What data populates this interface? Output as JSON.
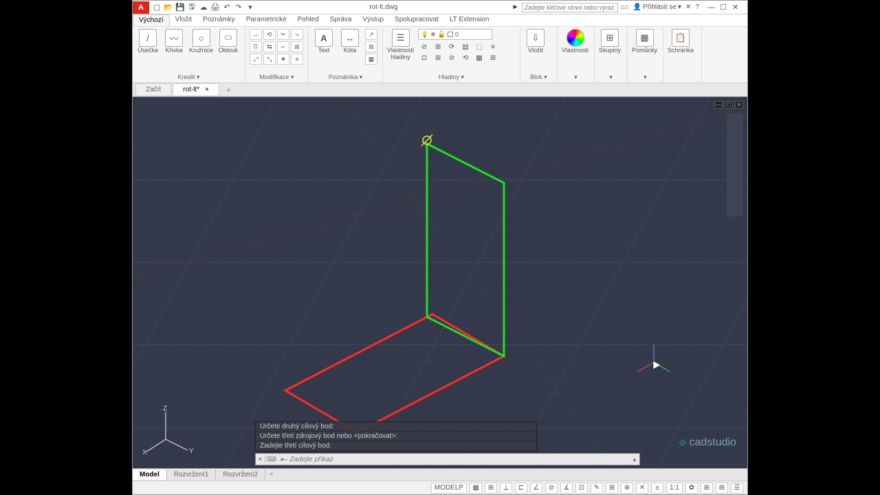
{
  "title": {
    "doc": "rot-lt.dwg",
    "app_badge": "A"
  },
  "qat_icons": [
    "new",
    "open",
    "save",
    "saveas",
    "cloud",
    "plot",
    "undo",
    "redo"
  ],
  "search": {
    "placeholder": "Zadejte klíčové slovo nebo výraz.",
    "arrow": "►"
  },
  "title_right": {
    "share": "⌂⌂",
    "signin": "Přihlásit se",
    "exchange": "✕",
    "help": "?",
    "min": "—",
    "max": "☐",
    "close": "✕"
  },
  "ribbon_tabs": [
    "Výchozí",
    "Vložit",
    "Poznámky",
    "Parametrické",
    "Pohled",
    "Správa",
    "Výstup",
    "Spolupracovat",
    "LT Extension"
  ],
  "ribbon_active": 0,
  "panels": {
    "draw": {
      "title": "Kreslit ▾",
      "btns": [
        {
          "icon": "/",
          "label": "Úsečka"
        },
        {
          "icon": "〰",
          "label": "Křivka"
        },
        {
          "icon": "○",
          "label": "Kružnice"
        },
        {
          "icon": "⬭",
          "label": "Oblouk"
        }
      ],
      "grid": [
        "□",
        "⟳",
        "·",
        "⊞",
        "⌇",
        "⬡",
        "·",
        "◆"
      ]
    },
    "modify": {
      "title": "Modifikace ▾",
      "grid": [
        "↔",
        "Ȼ",
        "⤷",
        "⤢",
        "✂",
        "⟲",
        "⇲",
        "⌐",
        "⬚",
        "⊞",
        "⟋",
        "⊘",
        "⋮",
        "□",
        "▦",
        "⬚"
      ]
    },
    "anno": {
      "title": "Poznámka ▾",
      "btns": [
        {
          "icon": "A",
          "label": "Text"
        },
        {
          "icon": "↔",
          "label": "Kóta"
        }
      ],
      "grid": [
        "↗",
        "⊡",
        "▤",
        "⊞",
        "⊏",
        "▦"
      ]
    },
    "layers": {
      "title": "Hladiny ▾",
      "big": {
        "icon": "☰",
        "label": "Vlastnosti\nhladiny"
      },
      "dropdown_items": [
        "💡",
        "❄",
        "🔒",
        "⬜",
        "0"
      ],
      "grid": [
        "💡",
        "❄",
        "🔒",
        "🎨",
        "⊞",
        "≡",
        "⊘",
        "⟳",
        "⬚",
        "▤",
        "⊞",
        "⊞"
      ]
    },
    "block": {
      "title": "Blok ▾",
      "big": {
        "icon": "⇩",
        "label": "Vložit"
      }
    },
    "props": {
      "title": "▾",
      "big": {
        "icon": "◐",
        "label": "Vlastnosti"
      }
    },
    "groups": {
      "title": "▾",
      "big": {
        "icon": "⊞",
        "label": "Skupiny"
      }
    },
    "utils": {
      "title": "▾",
      "big": {
        "icon": "▦",
        "label": "Pomůcky"
      }
    },
    "clip": {
      "title": "",
      "big": {
        "icon": "📋",
        "label": "Schránka"
      }
    }
  },
  "doc_tabs": [
    {
      "label": "Začít",
      "close": ""
    },
    {
      "label": "rot-lt*",
      "close": "×"
    }
  ],
  "doc_tab_active": 1,
  "doc_tab_plus": "+",
  "viewport_btns": [
    "—",
    "☐",
    "✕"
  ],
  "ucs": {
    "z": "Z",
    "x": "X",
    "y": "Y"
  },
  "cmd_history": [
    "Určete druhý cílový bod:",
    "Určete třetí zdrojový bod nebo <pokračovat>:",
    "Zadejte třetí cílový bod:"
  ],
  "cmd_line": {
    "close": "×",
    "icon": "⌨",
    "prompt": "▸– Zadejte příkaz",
    "arrow": "▴"
  },
  "watermark": {
    "icon": "⟐",
    "text": "cadstudio"
  },
  "layout_tabs": [
    "Model",
    "Rozvržení1",
    "Rozvržení2"
  ],
  "layout_active": 0,
  "layout_plus": "+",
  "status": {
    "space": "MODELP",
    "btns": [
      "▦",
      "⊞",
      "⟂",
      "⊏",
      "∠",
      "⊘",
      "∡",
      "⊡",
      "✎",
      "⊞",
      "⊕",
      "✕",
      "±",
      "1:1",
      "✿",
      "⊞",
      "⊞",
      "☰"
    ]
  }
}
